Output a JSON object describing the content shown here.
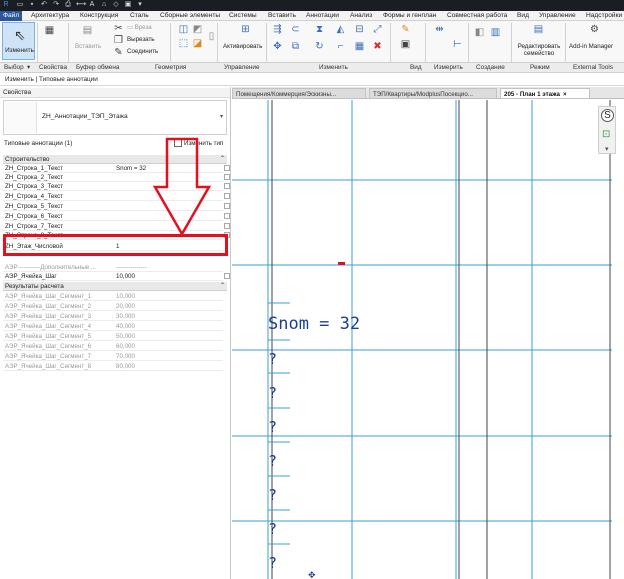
{
  "ribbon_tabs": [
    "Файл",
    "Архитектура",
    "Конструкция",
    "Сталь",
    "Сборные элементы",
    "Системы",
    "Вставить",
    "Аннотации",
    "Анализ",
    "Формы и генплан",
    "Совместная работа",
    "Вид",
    "Управление",
    "Надстройки"
  ],
  "ribbon": {
    "modify": "Изменить",
    "copy": "Вставить",
    "cut_label": "Вырезать",
    "join_label": "Соединить",
    "activate": "Активировать",
    "edit_family": "Редактировать семейство",
    "addin_manager": "Add-in Manager"
  },
  "ribbon_groups": [
    "Выбор",
    "Свойства",
    "Буфер обмена",
    "Геометрия",
    "Управление",
    "Изменить",
    "Вид",
    "Измерить",
    "Создание",
    "Режим",
    "External Tools"
  ],
  "context_bar": "Изменить | Типовые аннотации",
  "properties": {
    "panel_title": "Свойства",
    "type_name": "ZH_Аннотации_ТЭП_Этажа",
    "instances": "Типовые аннотации (1)",
    "edit_type": "Изменить тип",
    "category_construction": "Строительство",
    "rows": [
      {
        "k": "ZH_Строка_1_Текст",
        "v": "Snom = 32"
      },
      {
        "k": "ZH_Строка_2_Текст",
        "v": ""
      },
      {
        "k": "ZH_Строка_3_Текст",
        "v": ""
      },
      {
        "k": "ZH_Строка_4_Текст",
        "v": ""
      },
      {
        "k": "ZH_Строка_5_Текст",
        "v": ""
      },
      {
        "k": "ZH_Строка_6_Текст",
        "v": ""
      },
      {
        "k": "ZH_Строка_7_Текст",
        "v": ""
      },
      {
        "k": "ZH_Строка_8_Текст",
        "v": ""
      }
    ],
    "floor_row": {
      "k": "ZH_Этаж_Числовой",
      "v": "1"
    },
    "other_rows": [
      {
        "k": "АЭР-----------Дополнительные ...",
        "v": "---------------"
      },
      {
        "k": "АЭР_Ячейка_Шаг",
        "v": "10,000"
      }
    ],
    "category_results": "Результаты расчета",
    "results": [
      {
        "k": "АЭР_Ячейка_Шаг_Сегмент_1",
        "v": "10,000"
      },
      {
        "k": "АЭР_Ячейка_Шаг_Сегмент_2",
        "v": "20,000"
      },
      {
        "k": "АЭР_Ячейка_Шаг_Сегмент_3",
        "v": "30,000"
      },
      {
        "k": "АЭР_Ячейка_Шаг_Сегмент_4",
        "v": "40,000"
      },
      {
        "k": "АЭР_Ячейка_Шаг_Сегмент_5",
        "v": "50,000"
      },
      {
        "k": "АЭР_Ячейка_Шаг_Сегмент_6",
        "v": "60,000"
      },
      {
        "k": "АЭР_Ячейка_Шаг_Сегмент_7",
        "v": "70,000"
      },
      {
        "k": "АЭР_Ячейка_Шаг_Сегмент_8",
        "v": "80,000"
      }
    ]
  },
  "view_tabs": [
    {
      "label": "Помещения/Коммерция/Эскизны...",
      "active": false
    },
    {
      "label": "ТЭП/Квартиры/ModplusПосекцио...",
      "active": false
    },
    {
      "label": "205 - План 1 этажа",
      "active": true
    }
  ],
  "canvas": {
    "annotation": "Snom = 32",
    "question_marks": [
      "?",
      "?",
      "?",
      "?",
      "?",
      "?",
      "?"
    ]
  },
  "colors": {
    "accent": "#2b579a",
    "highlight": "#e1111f",
    "annotation": "#1c3e91",
    "grid": "#3b9fd8"
  }
}
